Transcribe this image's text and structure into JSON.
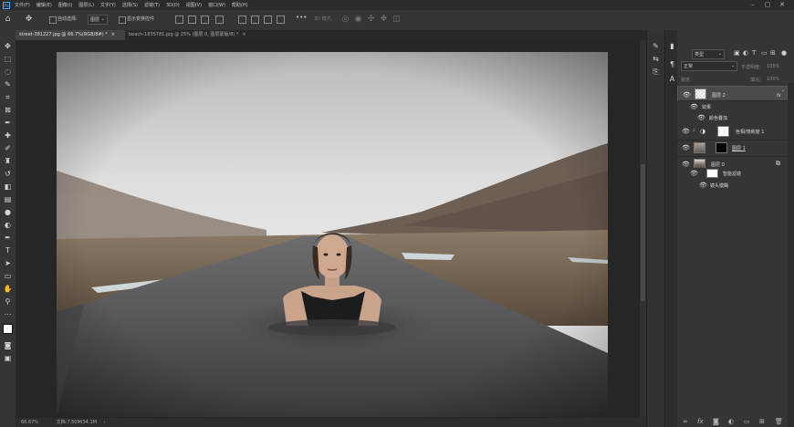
{
  "app": {
    "logo": "Ps"
  },
  "menubar": {
    "items": [
      "文件(F)",
      "编辑(E)",
      "图像(I)",
      "图层(L)",
      "文字(Y)",
      "选择(S)",
      "滤镜(T)",
      "3D(D)",
      "视图(V)",
      "窗口(W)",
      "帮助(H)"
    ]
  },
  "options": {
    "auto_select_label": "自动选择:",
    "auto_select_value": "图层",
    "show_transform_label": "显示变换控件",
    "mode_3d_label": "3D 模式:",
    "more": "•••"
  },
  "tabs": [
    {
      "label": "street-381227.jpg @ 66.7%(RGB/8#) *",
      "close": "×",
      "active": true
    },
    {
      "label": "beach-1835781.jpg @ 25% (图层 0, 图层蒙版/8) *",
      "close": "×",
      "active": false
    }
  ],
  "status": {
    "zoom": "66.67%",
    "doc": "文档:7.50M/34.1M",
    "arrow": "›"
  },
  "layers_panel": {
    "kind_label": "类型",
    "blend_mode": "正常",
    "opacity_label": "不透明度:",
    "opacity_value": "100%",
    "lock_label": "锁定:",
    "fill_label": "填充:",
    "fill_value": "100%",
    "layers": [
      {
        "name": "图层 2",
        "fx": "fx",
        "selected": true
      },
      {
        "name": "效果",
        "sub": true
      },
      {
        "name": "颜色叠加",
        "sub": true
      },
      {
        "name": "色相/饱和度 1"
      },
      {
        "name": "图层 1"
      },
      {
        "name": "图层 0"
      },
      {
        "name": "智能滤镜",
        "sub": true
      },
      {
        "name": "镜头模糊",
        "sub": true
      }
    ],
    "bottom_icons": [
      "link-icon",
      "fx-icon",
      "mask-icon",
      "adjustment-icon",
      "folder-icon",
      "new-layer-icon",
      "trash-icon"
    ]
  },
  "colors": {
    "accent": "#4aa3ff",
    "panel": "#353535",
    "selected_layer": "#4b4b4b"
  }
}
